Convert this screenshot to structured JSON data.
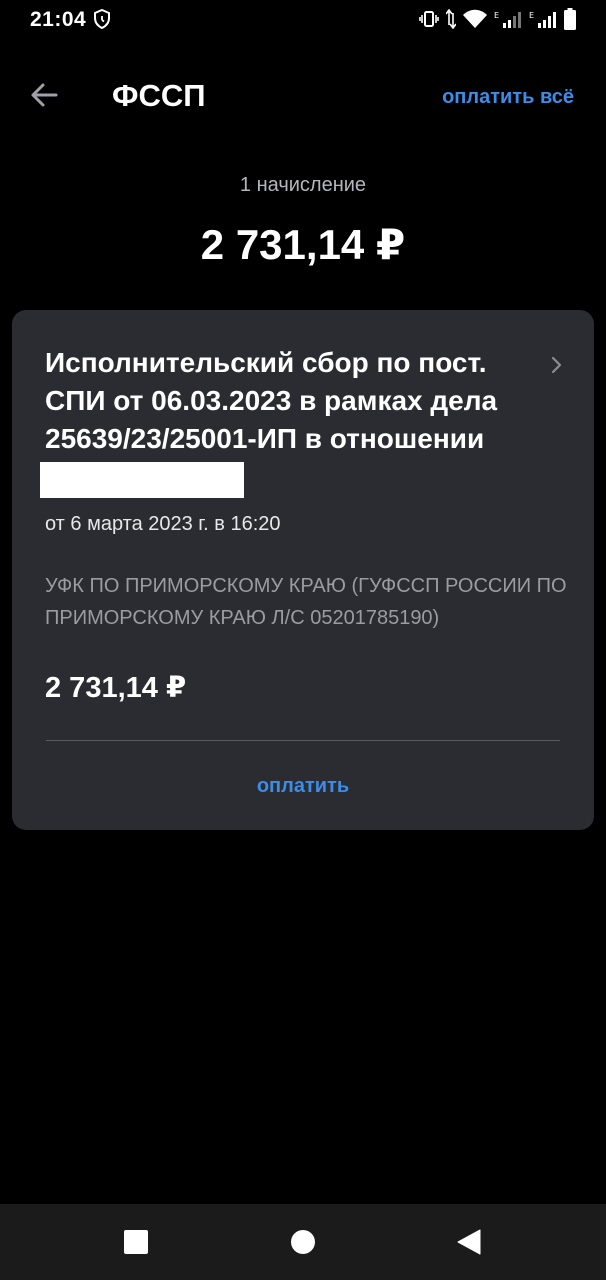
{
  "status_bar": {
    "time": "21:04",
    "icons": [
      "shield-icon",
      "vibrate-icon",
      "data-arrows-icon",
      "wifi-icon",
      "signal-icon",
      "signal-icon",
      "battery-icon"
    ]
  },
  "header": {
    "back_icon": "arrow-left-icon",
    "title": "ФССП",
    "pay_all_label": "оплатить всё"
  },
  "summary": {
    "count_label": "1 начисление",
    "total": "2 731,14 ₽"
  },
  "charge": {
    "title": "Исполнительский сбор по пост. СПИ от 06.03.2023 в рамках дела 25639/23/25001-ИП в отношении",
    "date": "от 6 марта 2023 г. в 16:20",
    "recipient": "УФК ПО ПРИМОРСКОМУ КРАЮ (ГУФССП РОССИИ ПО ПРИМОРСКОМУ КРАЮ Л/С 05201785190)",
    "amount": "2 731,14 ₽",
    "pay_label": "оплатить"
  },
  "colors": {
    "background": "#000000",
    "card": "#2b2c31",
    "accent": "#3d8ce6",
    "muted_text": "#9a9ca2"
  },
  "nav_bar": {
    "buttons": [
      "recents-square-icon",
      "home-circle-icon",
      "back-triangle-icon"
    ]
  }
}
